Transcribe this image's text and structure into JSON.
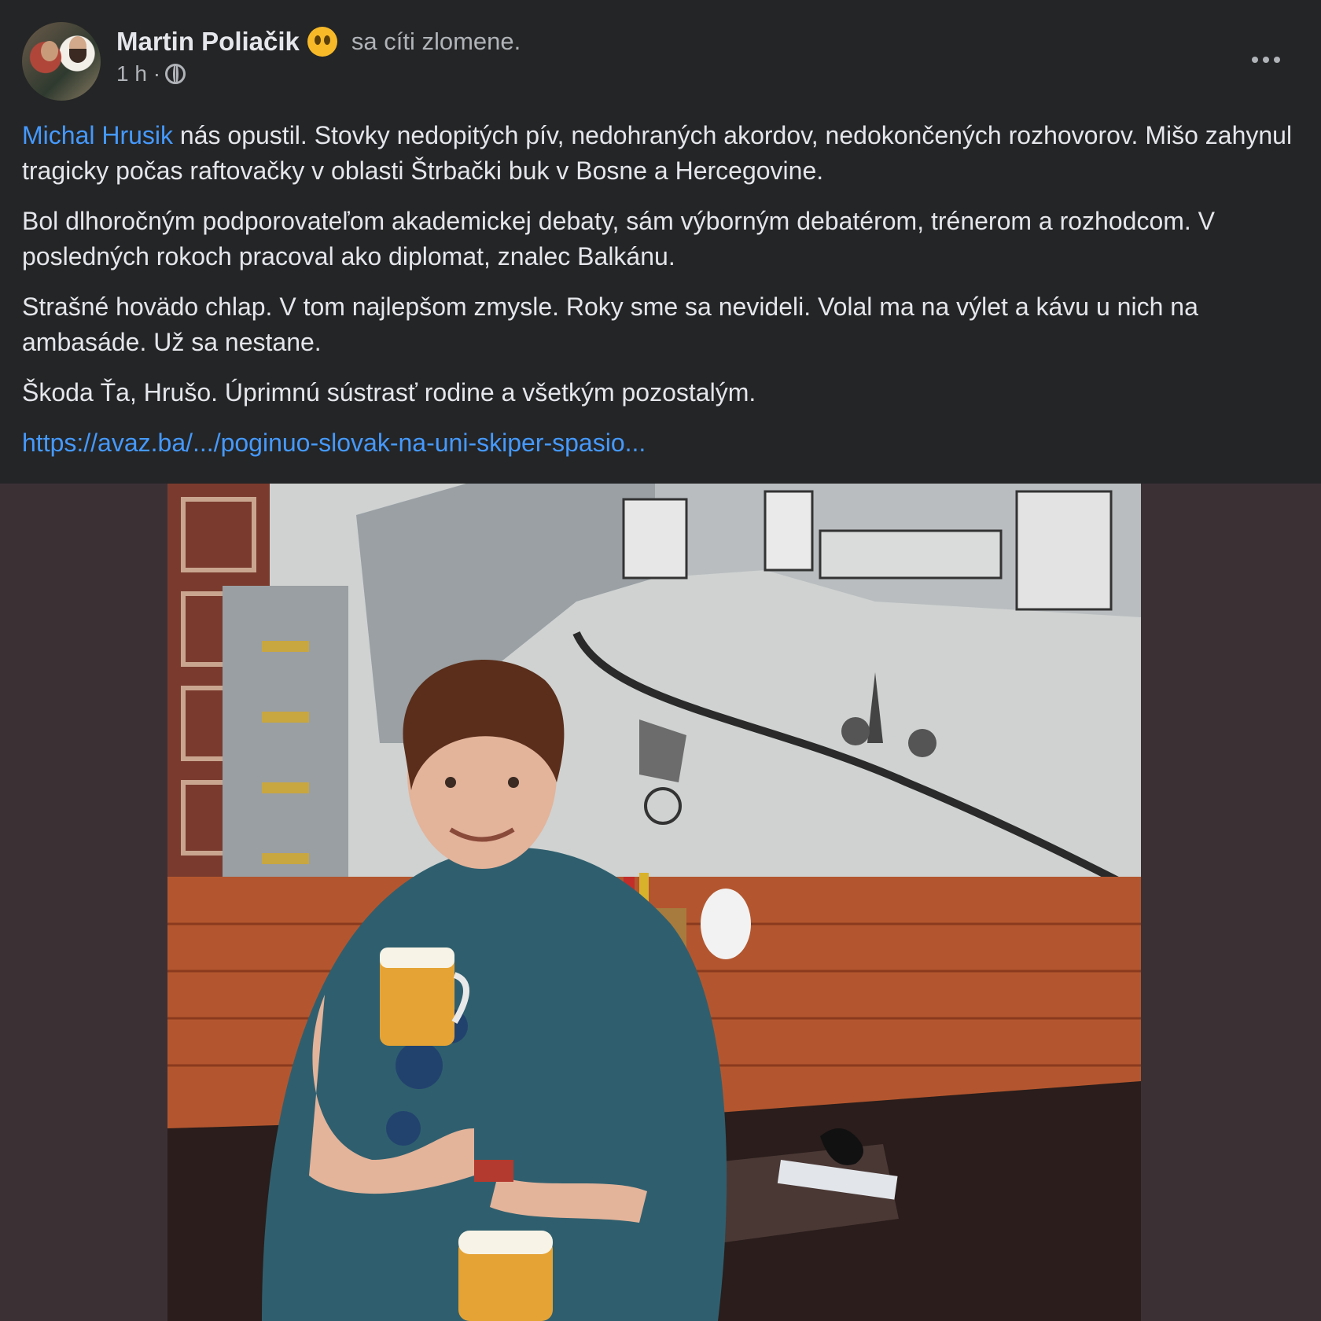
{
  "post": {
    "author": "Martin Poliačik",
    "feeling": "sa cíti zlomene.",
    "timestamp": "1 h ·",
    "more_icon": "more-horizontal-icon",
    "privacy_icon": "globe-icon",
    "mention": "Michal Hrusik",
    "paragraphs": [
      " nás opustil. Stovky nedopitých pív, nedohraných akordov, nedokončených rozhovorov. Mišo zahynul tragicky počas raftovačky v oblasti Štrbački buk v Bosne a Hercegovine.",
      "Bol dlhoročným podporovateľom akademickej debaty, sám výborným debatérom, trénerom a rozhodcom. V posledných rokoch pracoval ako diplomat, znalec Balkánu.",
      "Strašné hovädo chlap. V tom najlepšom zmysle. Roky sme sa nevideli. Volal ma na výlet a kávu u nich na ambasáde. Už sa nestane.",
      "Škoda Ťa, Hrušo. Úprimnú sústrasť rodine a všetkým pozostalým."
    ],
    "link": "https://avaz.ba/.../poginuo-slovak-na-uni-skiper-spasio..."
  },
  "colors": {
    "background": "#242526",
    "link": "#4599ff",
    "secondary_text": "#b0b3b8",
    "photo_letterbox": "#3b3135"
  }
}
